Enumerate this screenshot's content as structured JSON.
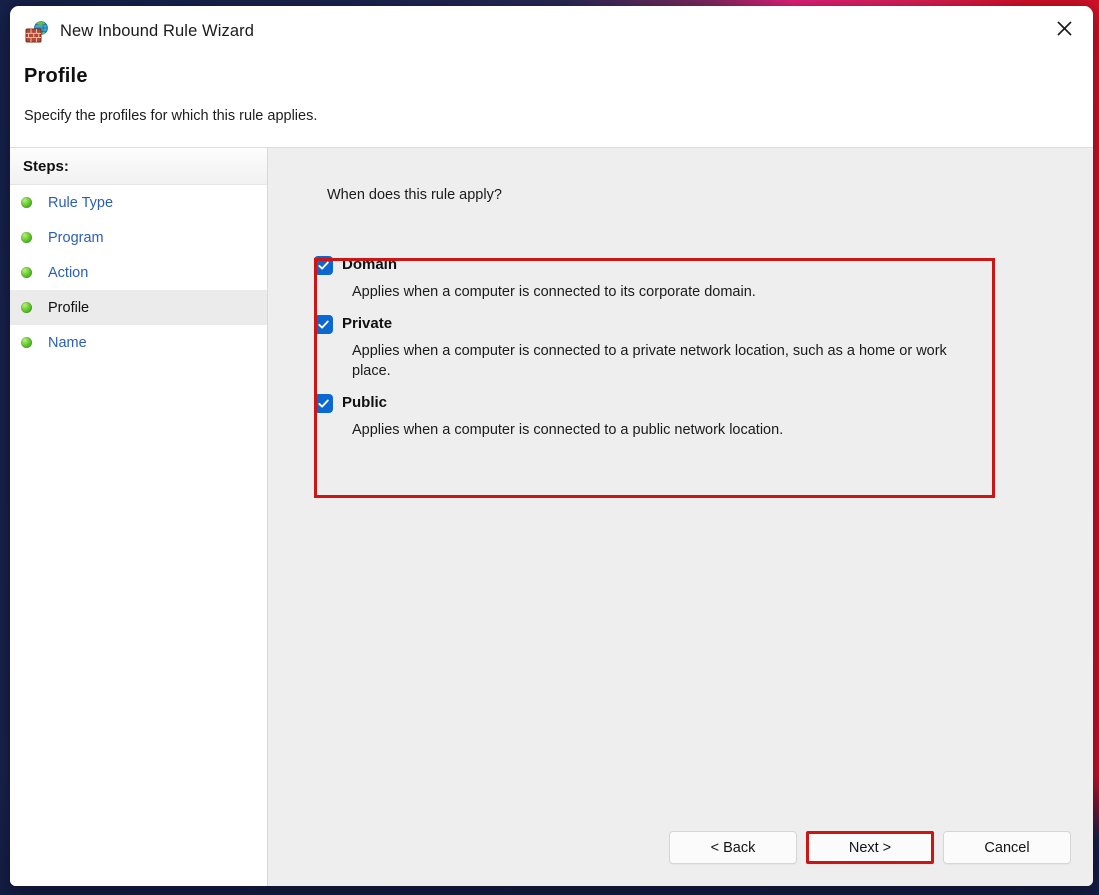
{
  "window": {
    "title": "New Inbound Rule Wizard",
    "icon": "firewall-globe-icon",
    "close_label": "✕"
  },
  "header": {
    "title": "Profile",
    "subtitle": "Specify the profiles for which this rule applies."
  },
  "sidebar": {
    "heading": "Steps:",
    "items": [
      {
        "label": "Rule Type",
        "current": false
      },
      {
        "label": "Program",
        "current": false
      },
      {
        "label": "Action",
        "current": false
      },
      {
        "label": "Profile",
        "current": true
      },
      {
        "label": "Name",
        "current": false
      }
    ]
  },
  "main": {
    "question": "When does this rule apply?",
    "options": [
      {
        "name": "Domain",
        "checked": true,
        "description": "Applies when a computer is connected to its corporate domain."
      },
      {
        "name": "Private",
        "checked": true,
        "description": "Applies when a computer is connected to a private network location, such as a home or work place."
      },
      {
        "name": "Public",
        "checked": true,
        "description": "Applies when a computer is connected to a public network location."
      }
    ]
  },
  "footer": {
    "back_label": "< Back",
    "next_label": "Next >",
    "cancel_label": "Cancel"
  },
  "annotations": {
    "accent_color": "#cc1616",
    "highlighted_button": "Next >",
    "highlighted_region": "profile-options-group"
  },
  "colors": {
    "checkbox_blue": "#0a68d0",
    "link_blue": "#2a5fb5",
    "step_bullet_green": "#68ca32",
    "content_background": "#eeeeee"
  }
}
